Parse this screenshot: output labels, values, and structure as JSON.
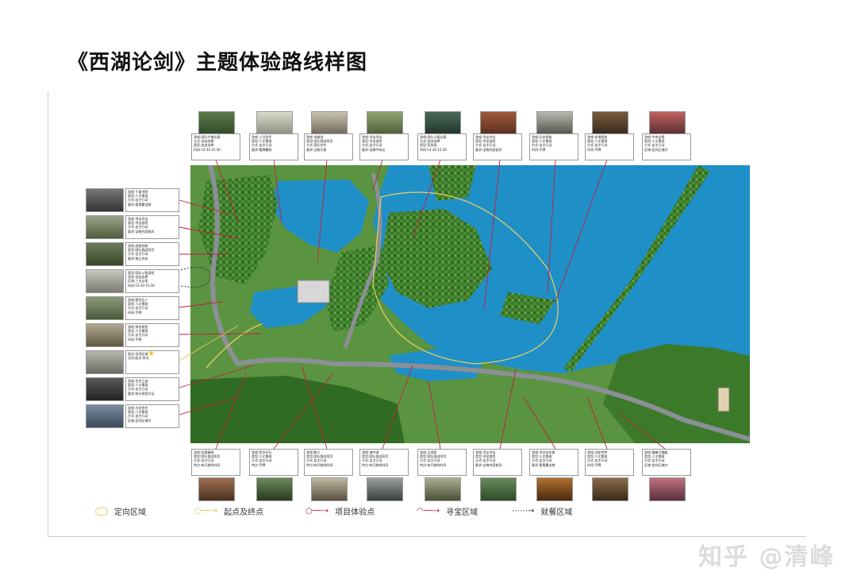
{
  "title": "《西湖论剑》主题体验路线样图",
  "watermark": "知乎 @清峰",
  "legend": [
    {
      "label": "定向区域",
      "icon": "orienteering-area-icon",
      "color": "#e8d060"
    },
    {
      "label": "起点及终点",
      "icon": "start-end-point-icon",
      "color": "#d9c45a"
    },
    {
      "label": "项目体验点",
      "icon": "experience-point-icon",
      "color": "#c0203a"
    },
    {
      "label": "寻宝区域",
      "icon": "treasure-area-icon",
      "color": "#c0203a"
    },
    {
      "label": "就餐区域",
      "icon": "dining-area-icon",
      "color": "#333333"
    }
  ],
  "top_cards": [
    {
      "text": "游戏:团队牛拳比赛\n方式:自由选择\n类型:自由选择\n时间:14:30-15:30"
    },
    {
      "text": "游戏:三分剑手\n类型:人文景观\n方式:自主行动\n要求:看牌赢取"
    },
    {
      "text": "游戏:卓越剑\n类型:团队挑战项目\n方式:团队合作\n要求:全数开放"
    },
    {
      "text": "游戏:寻宝寻宝\n类型:寻宝游戏\n方式:自主行动\n要求:宝物中有尖"
    },
    {
      "text": "游戏:团队斗智比赛\n方式:自由选择\n类型:竞技类\n时间:14:30-15:30"
    },
    {
      "text": "游戏:寻宝寻宝\n类型:寻宝游戏\n方式:自主行动\n要求:宝物内容各异"
    },
    {
      "text": "游戏:历史探秘\n类型:人文景观\n方式:自主行动\n时间:手牌"
    },
    {
      "text": "游戏:花港观鱼\n类型:人文景观\n方式:自主行动\n时间:手牌"
    },
    {
      "text": "游戏:牛肉会馆\n类型:人文景观\n方式:自主行动\n区域:定向区域内"
    }
  ],
  "left_cards": [
    {
      "text": "游戏:千道书院\n类型:人文景观\n方式:自主行动\n要求:看景赢宝物"
    },
    {
      "text": "游戏:寻宝寻宝\n类型:寻宝游戏\n方式:自主行动\n要求:宝物内容各异"
    },
    {
      "text": "游戏:虎跑剑阁\n类型:团队挑战项目\n方式:自主行动\n要求:独立完成"
    },
    {
      "text": "类型:团队斗智游戏\n游戏:自由选择\n区域:三台云舍\n时间:14:30-15:30"
    },
    {
      "text": "游戏:赛剑达人\n类型:人文景观\n方式:自主行动\n时间:手牌"
    },
    {
      "text": "游戏:赏花观鱼\n类型:人文景观\n方式:自主行动\n时间:手牌"
    },
    {
      "text": "地点:岳坟区域\n活动:起点·终点"
    },
    {
      "text": "游戏:龙井之谜\n类型:人文景观\n方式:自主行动\n要求:统计答案为证"
    },
    {
      "text": "游戏:乌龙茶井\n类型:人文景观\n方式:自主行动\n区域:定向区域内"
    }
  ],
  "bottom_cards": [
    {
      "text": "游戏:苏堤春晓\n类型:团队挑战项目\n方式:自主行动\n特点:有开放的时间"
    },
    {
      "text": "游戏:西泠印社\n类型:人文景观\n方式:自主行动\n特点:手牌"
    },
    {
      "text": "游戏:断七\n类型:团队挑战项目\n方式:自主行动\n特点:有开放的时间"
    },
    {
      "text": "游戏:湖中湖\n类型:团队挑战项目\n方式:自主行动\n特点:有开放的时间"
    },
    {
      "text": "游戏:汉语帮\n类型:团队挑战项目\n方式:自主行动\n特点:有开放的时间"
    },
    {
      "text": "游戏:寻宝寻宝\n类型:寻宝游戏\n方式:自主行动\n要求:宝物内容各异"
    },
    {
      "text": "游戏:寻访苏东坡\n类型:人文景观\n方式:自主行动\n要求:看景赢宝物"
    },
    {
      "text": "游戏:白蛇传传\n类型:人文景观\n方式:自主行动\n时间:手牌"
    },
    {
      "text": "游戏:雷峰大佛殿\n类型:人文景观\n方式:自主行动\n区域:定向区域内"
    }
  ],
  "colors": {
    "lake": "#1f8fc8",
    "land": "#3f7f2e",
    "road": "#8b8f96",
    "accent": "#c0203a"
  }
}
